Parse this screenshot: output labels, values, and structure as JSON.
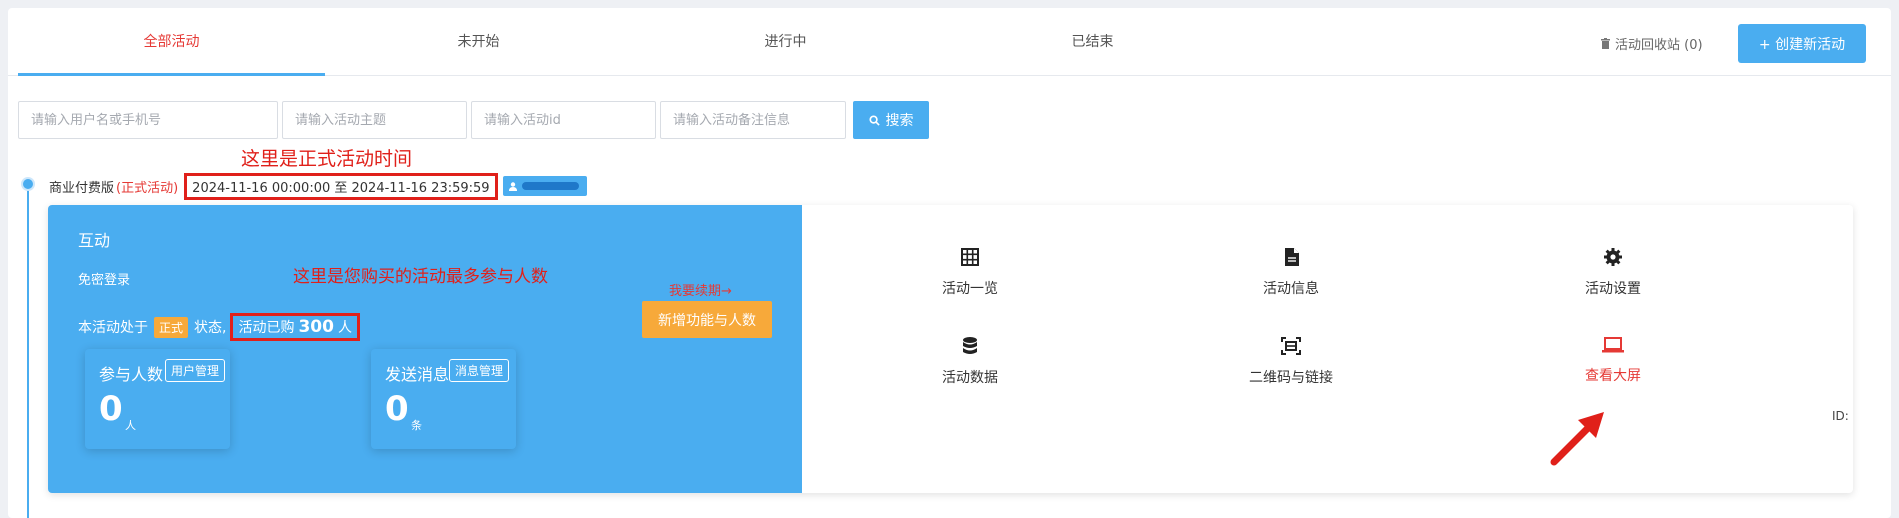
{
  "tabs": [
    {
      "label": "全部活动"
    },
    {
      "label": "未开始"
    },
    {
      "label": "进行中"
    },
    {
      "label": "已结束"
    }
  ],
  "recycle": {
    "label": "活动回收站 (0)"
  },
  "create_button": {
    "label": "+ 创建新活动"
  },
  "search": {
    "user_placeholder": "请输入用户名或手机号",
    "theme_placeholder": "请输入活动主题",
    "id_placeholder": "请输入活动id",
    "note_placeholder": "请输入活动备注信息",
    "button_label": "搜索"
  },
  "annotations": {
    "time_note": "这里是正式活动时间",
    "people_note": "这里是您购买的活动最多参与人数"
  },
  "activity": {
    "edition": "商业付费版",
    "formal_tag": "(正式活动)",
    "time_range": "2024-11-16 00:00:00 至 2024-11-16 23:59:59",
    "title": "互动",
    "login_mode": "免密登录",
    "renew_link": "我要续期→",
    "status_prefix": "本活动处于",
    "status_tag": "正式",
    "status_suffix": "状态,",
    "purchased_prefix": "活动已购",
    "purchased_count": "300",
    "purchased_unit": "人",
    "add_feature_button": "新增功能与人数",
    "participants": {
      "label": "参与人数",
      "button": "用户管理",
      "value": "0",
      "unit": "人"
    },
    "messages": {
      "label": "发送消息",
      "button": "消息管理",
      "value": "0",
      "unit": "条"
    },
    "id_label": "ID:"
  },
  "menu": [
    {
      "label": "活动一览",
      "icon": "table-icon"
    },
    {
      "label": "活动信息",
      "icon": "document-icon"
    },
    {
      "label": "活动设置",
      "icon": "gear-icon"
    },
    {
      "label": "活动数据",
      "icon": "database-icon"
    },
    {
      "label": "二维码与链接",
      "icon": "qrcode-scan-icon"
    },
    {
      "label": "查看大屏",
      "icon": "laptop-icon"
    }
  ],
  "colors": {
    "accent": "#4aadf0",
    "active_tab": "#e53935",
    "orange": "#f7a93a",
    "annotation_red": "#e0201a"
  }
}
